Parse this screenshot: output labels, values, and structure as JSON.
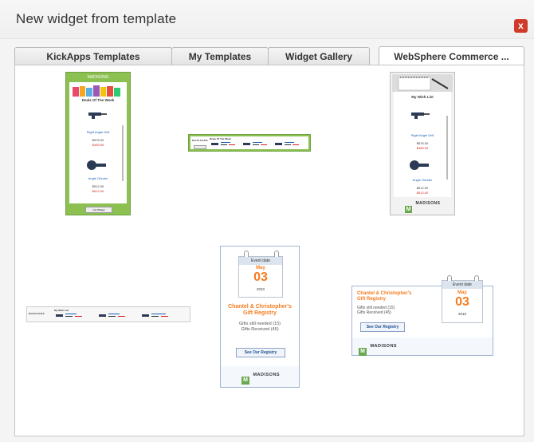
{
  "dialog": {
    "title": "New widget from template",
    "close_symbol": "x"
  },
  "tabs": [
    {
      "label": "KickApps Templates"
    },
    {
      "label": "My Templates"
    },
    {
      "label": "Widget Gallery"
    },
    {
      "label": "WebSphere Commerce ..."
    }
  ],
  "templates": {
    "deals": {
      "brand": "MADISONS",
      "heading": "Deals Of The Week",
      "items": [
        {
          "name": "Right Angle Drill",
          "price": "$576.00",
          "sale": "$489.99"
        },
        {
          "name": "Angle Grinder",
          "price": "$512.00",
          "sale": "$512.00"
        }
      ],
      "button": "Get Widget"
    },
    "deals_horizontal": {
      "brand": "MADISONS",
      "heading": "Deals Of The Week"
    },
    "wishlist": {
      "heading": "My Wish List",
      "brand": "MADISONS",
      "items": [
        {
          "name": "Right Angle Drill",
          "price": "$576.00",
          "sale": "$489.99"
        },
        {
          "name": "Angle Grinder",
          "price": "$512.00",
          "sale": "$512.00"
        }
      ]
    },
    "wishlist_horizontal": {
      "brand": "MADISONS",
      "heading": "My Wish List"
    },
    "registry_vertical": {
      "event_label": "Event date",
      "month": "May",
      "day": "03",
      "year": "2010",
      "title_line1": "Chantel & Christopher's",
      "title_line2": "Gift Registry",
      "stat1": "Gifts still needed (15)",
      "stat2": "Gifts Received (45)",
      "button": "See Our Registry",
      "brand": "MADISONS"
    },
    "registry_horizontal": {
      "event_label": "Event date",
      "month": "May",
      "day": "03",
      "year": "2010",
      "title_line1": "Chantel & Christopher's",
      "title_line2": "Gift Registry",
      "stat1": "Gifts still needed (15)",
      "stat2": "Gifts Received (45)",
      "button": "See Our Registry",
      "brand": "MADISONS"
    }
  }
}
